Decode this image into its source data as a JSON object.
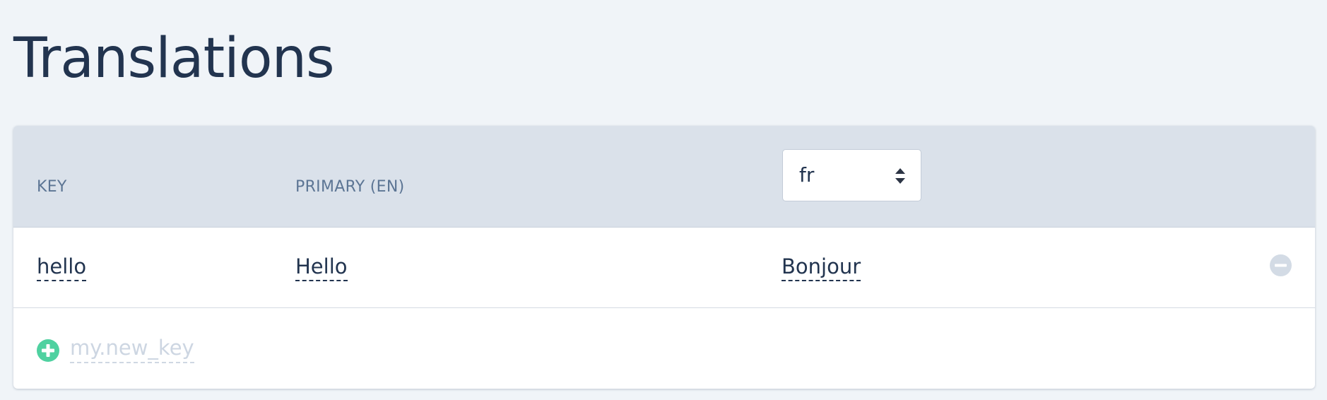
{
  "page": {
    "title": "Translations"
  },
  "table": {
    "headers": {
      "key": "KEY",
      "primary": "PRIMARY (EN)"
    },
    "locale_select": {
      "selected": "fr",
      "icon": "sort-arrows-icon"
    },
    "rows": [
      {
        "key": "hello",
        "primary": "Hello",
        "translation": "Bonjour",
        "remove_icon": "minus-circle-icon"
      }
    ],
    "new_row": {
      "add_icon": "plus-circle-icon",
      "placeholder": "my.new_key"
    }
  },
  "colors": {
    "background": "#f0f4f8",
    "header_background": "#dae1ea",
    "text": "#22344f",
    "header_text": "#5c7594",
    "add_green": "#4fd1a0",
    "remove_gray": "#d3dbe5"
  }
}
